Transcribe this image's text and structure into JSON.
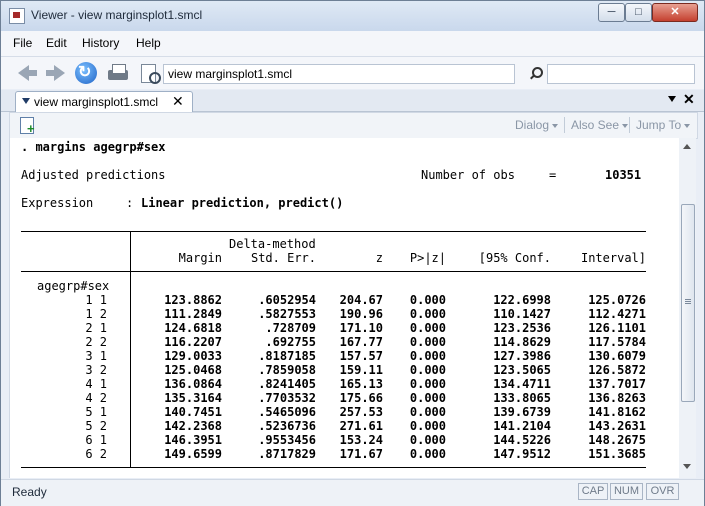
{
  "window": {
    "title": "Viewer - view marginsplot1.smcl",
    "min_label": "─",
    "max_label": "□",
    "close_label": "✕"
  },
  "menu": [
    "File",
    "Edit",
    "History",
    "Help"
  ],
  "toolbar": {
    "address": "view marginsplot1.smcl",
    "search_value": ""
  },
  "tabs": [
    {
      "label": "view marginsplot1.smcl",
      "close": "✕"
    }
  ],
  "tabs_close": "✕",
  "viewer_toolbar": {
    "dialog": "Dialog",
    "also_see": "Also See",
    "jump_to": "Jump To"
  },
  "output": {
    "command": ". margins agegrp#sex",
    "header_left": "Adjusted predictions",
    "nobs_label": "Number of obs",
    "nobs_eq": "=",
    "nobs_value": "10351",
    "expression_label": "Expression",
    "expression_colon": ":",
    "expression_value": "Linear prediction, predict()",
    "header_delta": "Delta-method",
    "columns": [
      "Margin",
      "Std. Err.",
      "z",
      "P>|z|",
      "[95% Conf.",
      "Interval]"
    ],
    "group_label": "agegrp#sex",
    "rows": [
      {
        "label": "1 1",
        "values": [
          "123.8862",
          ".6052954",
          "204.67",
          "0.000",
          "122.6998",
          "125.0726"
        ]
      },
      {
        "label": "1 2",
        "values": [
          "111.2849",
          ".5827553",
          "190.96",
          "0.000",
          "110.1427",
          "112.4271"
        ]
      },
      {
        "label": "2 1",
        "values": [
          "124.6818",
          ".728709",
          "171.10",
          "0.000",
          "123.2536",
          "126.1101"
        ]
      },
      {
        "label": "2 2",
        "values": [
          "116.2207",
          ".692755",
          "167.77",
          "0.000",
          "114.8629",
          "117.5784"
        ]
      },
      {
        "label": "3 1",
        "values": [
          "129.0033",
          ".8187185",
          "157.57",
          "0.000",
          "127.3986",
          "130.6079"
        ]
      },
      {
        "label": "3 2",
        "values": [
          "125.0468",
          ".7859058",
          "159.11",
          "0.000",
          "123.5065",
          "126.5872"
        ]
      },
      {
        "label": "4 1",
        "values": [
          "136.0864",
          ".8241405",
          "165.13",
          "0.000",
          "134.4711",
          "137.7017"
        ]
      },
      {
        "label": "4 2",
        "values": [
          "135.3164",
          ".7703532",
          "175.66",
          "0.000",
          "133.8065",
          "136.8263"
        ]
      },
      {
        "label": "5 1",
        "values": [
          "140.7451",
          ".5465096",
          "257.53",
          "0.000",
          "139.6739",
          "141.8162"
        ]
      },
      {
        "label": "5 2",
        "values": [
          "142.2368",
          ".5236736",
          "271.61",
          "0.000",
          "141.2104",
          "143.2631"
        ]
      },
      {
        "label": "6 1",
        "values": [
          "146.3951",
          ".9553456",
          "153.24",
          "0.000",
          "144.5226",
          "148.2675"
        ]
      },
      {
        "label": "6 2",
        "values": [
          "149.6599",
          ".8717829",
          "171.67",
          "0.000",
          "147.9512",
          "151.3685"
        ]
      }
    ]
  },
  "status": {
    "text": "Ready",
    "indicators": [
      "CAP",
      "NUM",
      "OVR"
    ]
  }
}
